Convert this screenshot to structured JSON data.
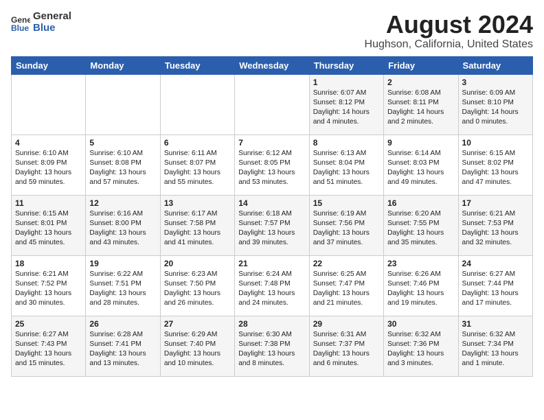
{
  "header": {
    "logo_general": "General",
    "logo_blue": "Blue",
    "month_title": "August 2024",
    "location": "Hughson, California, United States"
  },
  "weekdays": [
    "Sunday",
    "Monday",
    "Tuesday",
    "Wednesday",
    "Thursday",
    "Friday",
    "Saturday"
  ],
  "weeks": [
    [
      {
        "day": "",
        "info": ""
      },
      {
        "day": "",
        "info": ""
      },
      {
        "day": "",
        "info": ""
      },
      {
        "day": "",
        "info": ""
      },
      {
        "day": "1",
        "info": "Sunrise: 6:07 AM\nSunset: 8:12 PM\nDaylight: 14 hours\nand 4 minutes."
      },
      {
        "day": "2",
        "info": "Sunrise: 6:08 AM\nSunset: 8:11 PM\nDaylight: 14 hours\nand 2 minutes."
      },
      {
        "day": "3",
        "info": "Sunrise: 6:09 AM\nSunset: 8:10 PM\nDaylight: 14 hours\nand 0 minutes."
      }
    ],
    [
      {
        "day": "4",
        "info": "Sunrise: 6:10 AM\nSunset: 8:09 PM\nDaylight: 13 hours\nand 59 minutes."
      },
      {
        "day": "5",
        "info": "Sunrise: 6:10 AM\nSunset: 8:08 PM\nDaylight: 13 hours\nand 57 minutes."
      },
      {
        "day": "6",
        "info": "Sunrise: 6:11 AM\nSunset: 8:07 PM\nDaylight: 13 hours\nand 55 minutes."
      },
      {
        "day": "7",
        "info": "Sunrise: 6:12 AM\nSunset: 8:05 PM\nDaylight: 13 hours\nand 53 minutes."
      },
      {
        "day": "8",
        "info": "Sunrise: 6:13 AM\nSunset: 8:04 PM\nDaylight: 13 hours\nand 51 minutes."
      },
      {
        "day": "9",
        "info": "Sunrise: 6:14 AM\nSunset: 8:03 PM\nDaylight: 13 hours\nand 49 minutes."
      },
      {
        "day": "10",
        "info": "Sunrise: 6:15 AM\nSunset: 8:02 PM\nDaylight: 13 hours\nand 47 minutes."
      }
    ],
    [
      {
        "day": "11",
        "info": "Sunrise: 6:15 AM\nSunset: 8:01 PM\nDaylight: 13 hours\nand 45 minutes."
      },
      {
        "day": "12",
        "info": "Sunrise: 6:16 AM\nSunset: 8:00 PM\nDaylight: 13 hours\nand 43 minutes."
      },
      {
        "day": "13",
        "info": "Sunrise: 6:17 AM\nSunset: 7:58 PM\nDaylight: 13 hours\nand 41 minutes."
      },
      {
        "day": "14",
        "info": "Sunrise: 6:18 AM\nSunset: 7:57 PM\nDaylight: 13 hours\nand 39 minutes."
      },
      {
        "day": "15",
        "info": "Sunrise: 6:19 AM\nSunset: 7:56 PM\nDaylight: 13 hours\nand 37 minutes."
      },
      {
        "day": "16",
        "info": "Sunrise: 6:20 AM\nSunset: 7:55 PM\nDaylight: 13 hours\nand 35 minutes."
      },
      {
        "day": "17",
        "info": "Sunrise: 6:21 AM\nSunset: 7:53 PM\nDaylight: 13 hours\nand 32 minutes."
      }
    ],
    [
      {
        "day": "18",
        "info": "Sunrise: 6:21 AM\nSunset: 7:52 PM\nDaylight: 13 hours\nand 30 minutes."
      },
      {
        "day": "19",
        "info": "Sunrise: 6:22 AM\nSunset: 7:51 PM\nDaylight: 13 hours\nand 28 minutes."
      },
      {
        "day": "20",
        "info": "Sunrise: 6:23 AM\nSunset: 7:50 PM\nDaylight: 13 hours\nand 26 minutes."
      },
      {
        "day": "21",
        "info": "Sunrise: 6:24 AM\nSunset: 7:48 PM\nDaylight: 13 hours\nand 24 minutes."
      },
      {
        "day": "22",
        "info": "Sunrise: 6:25 AM\nSunset: 7:47 PM\nDaylight: 13 hours\nand 21 minutes."
      },
      {
        "day": "23",
        "info": "Sunrise: 6:26 AM\nSunset: 7:46 PM\nDaylight: 13 hours\nand 19 minutes."
      },
      {
        "day": "24",
        "info": "Sunrise: 6:27 AM\nSunset: 7:44 PM\nDaylight: 13 hours\nand 17 minutes."
      }
    ],
    [
      {
        "day": "25",
        "info": "Sunrise: 6:27 AM\nSunset: 7:43 PM\nDaylight: 13 hours\nand 15 minutes."
      },
      {
        "day": "26",
        "info": "Sunrise: 6:28 AM\nSunset: 7:41 PM\nDaylight: 13 hours\nand 13 minutes."
      },
      {
        "day": "27",
        "info": "Sunrise: 6:29 AM\nSunset: 7:40 PM\nDaylight: 13 hours\nand 10 minutes."
      },
      {
        "day": "28",
        "info": "Sunrise: 6:30 AM\nSunset: 7:38 PM\nDaylight: 13 hours\nand 8 minutes."
      },
      {
        "day": "29",
        "info": "Sunrise: 6:31 AM\nSunset: 7:37 PM\nDaylight: 13 hours\nand 6 minutes."
      },
      {
        "day": "30",
        "info": "Sunrise: 6:32 AM\nSunset: 7:36 PM\nDaylight: 13 hours\nand 3 minutes."
      },
      {
        "day": "31",
        "info": "Sunrise: 6:32 AM\nSunset: 7:34 PM\nDaylight: 13 hours\nand 1 minute."
      }
    ]
  ]
}
